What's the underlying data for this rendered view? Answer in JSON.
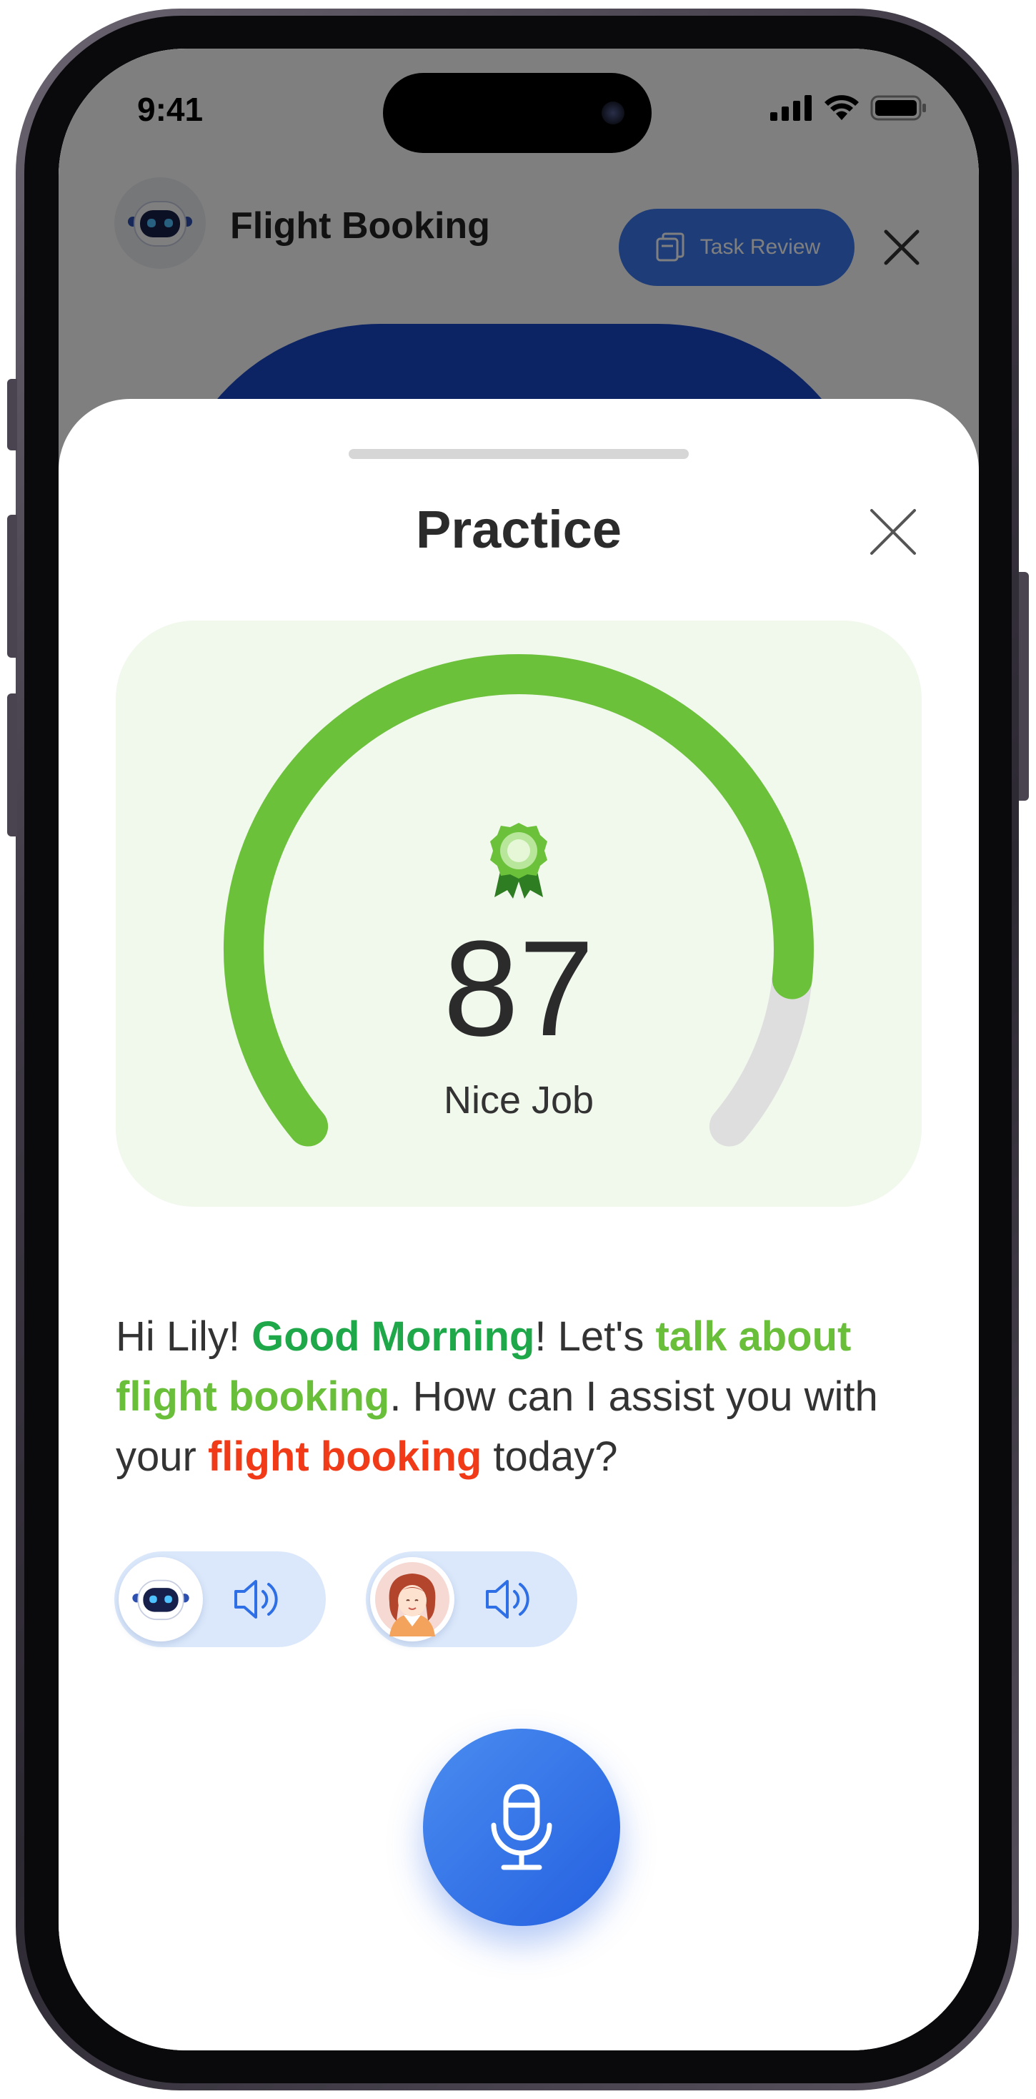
{
  "status_bar": {
    "time": "9:41"
  },
  "header": {
    "title": "Flight Booking",
    "task_review_label": "Task Review",
    "avatar_icon": "robot-icon",
    "close_icon": "close-icon"
  },
  "sheet": {
    "title": "Practice",
    "close_icon": "close-icon"
  },
  "score": {
    "value": "87",
    "label": "Nice Job",
    "fraction": 0.87,
    "badge_icon": "award-badge-icon",
    "colors": {
      "progress": "#6cc13a",
      "track": "#dedede",
      "card": "#f1f8ec"
    }
  },
  "message": {
    "part1": "Hi Lily!  ",
    "part2": "Good Morning",
    "part3": "! Let's ",
    "part4": "talk about flight booking",
    "part5": ". How can I assist you with your ",
    "part6": "flight booking",
    "part7": " today?",
    "colors": {
      "green": "#1fa84a",
      "lime": "#6abf3a",
      "red": "#f03a18"
    }
  },
  "audio": [
    {
      "speaker": "robot-avatar",
      "icon": "speaker-icon"
    },
    {
      "speaker": "girl-avatar",
      "icon": "speaker-icon"
    }
  ],
  "mic": {
    "icon": "microphone-icon",
    "color": "#2f6fe6"
  }
}
